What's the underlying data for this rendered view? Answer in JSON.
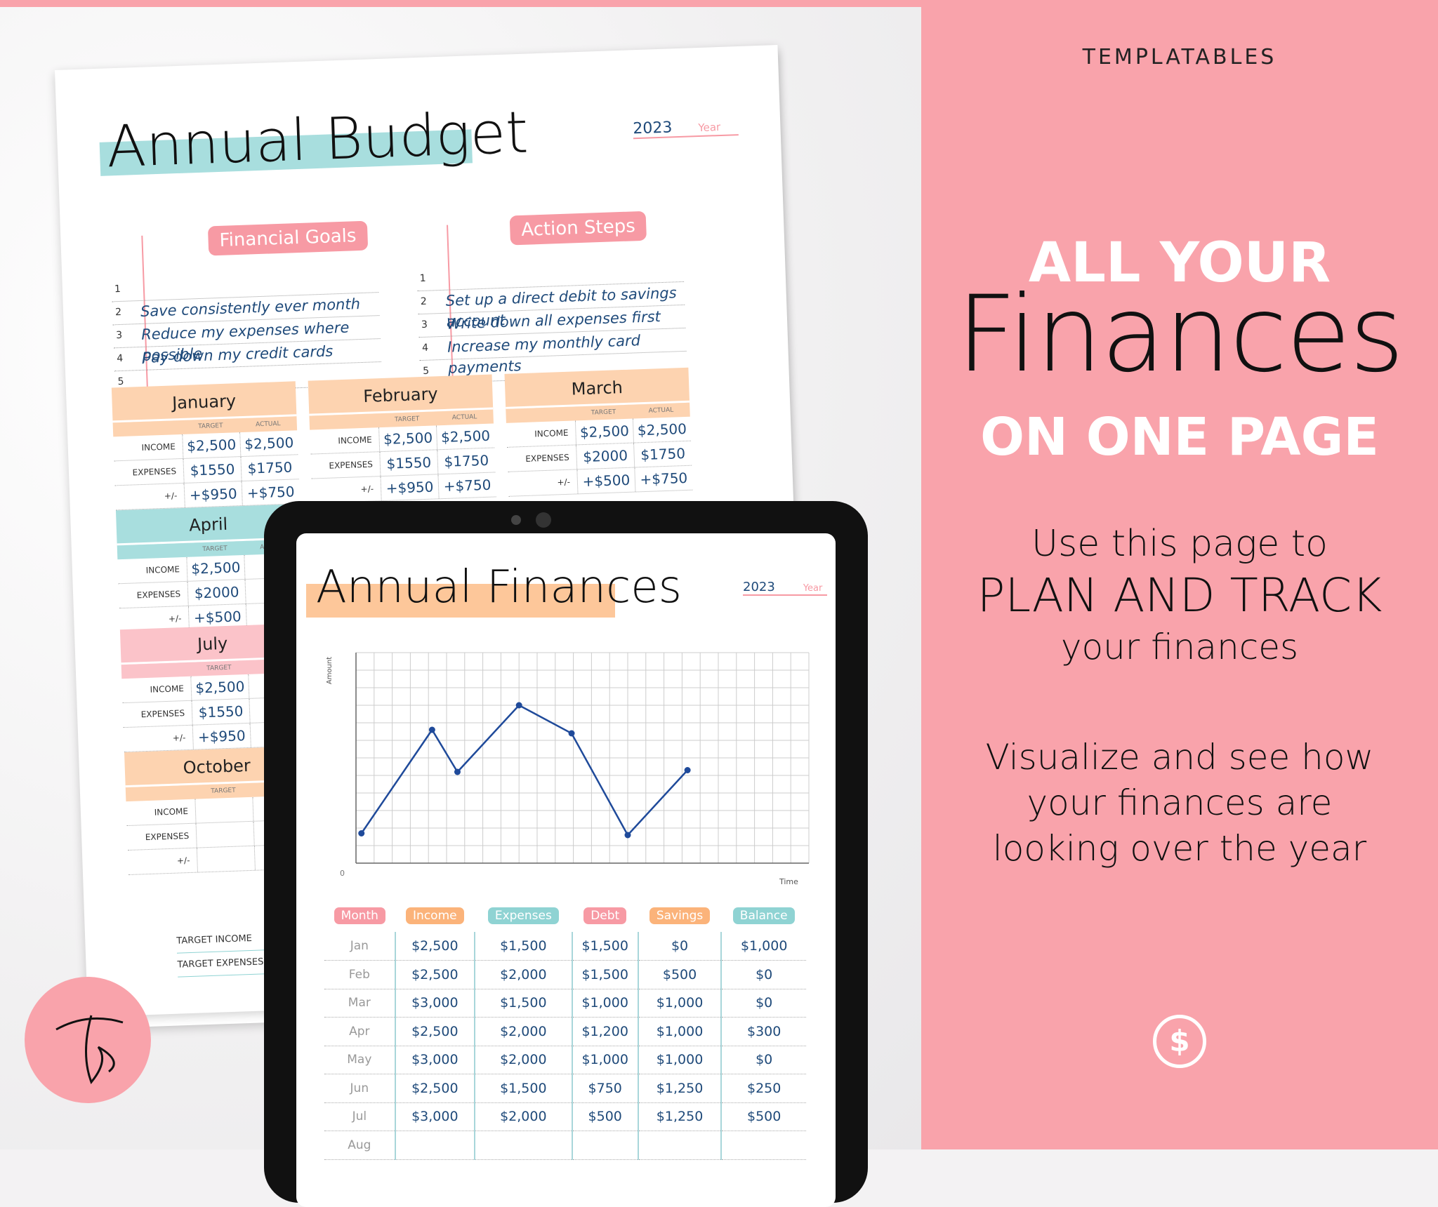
{
  "colors": {
    "pink": "#f9a3ab",
    "badge_pink": "#f79aa4",
    "teal": "#8fd3d3",
    "peach": "#fdd3b0",
    "orange": "#fbb37a",
    "navy": "#1f4a7a",
    "line": "#1f4a9a"
  },
  "budget": {
    "title": "Annual Budget",
    "year": "2023",
    "year_label": "Year",
    "goals_title": "Financial Goals",
    "steps_title": "Action Steps",
    "goals": [
      {
        "n": "1",
        "t": ""
      },
      {
        "n": "2",
        "t": "Save consistently ever month"
      },
      {
        "n": "3",
        "t": "Reduce my expenses where possible"
      },
      {
        "n": "4",
        "t": "Pay down my credit cards"
      },
      {
        "n": "5",
        "t": ""
      }
    ],
    "steps": [
      {
        "n": "1",
        "t": ""
      },
      {
        "n": "2",
        "t": "Set up a direct debit to savings account"
      },
      {
        "n": "3",
        "t": "Write down all expenses first"
      },
      {
        "n": "4",
        "t": "Increase my monthly card payments"
      },
      {
        "n": "5",
        "t": ""
      }
    ],
    "col_target": "TARGET",
    "col_actual": "ACTUAL",
    "row_labels": [
      "INCOME",
      "EXPENSES",
      "+/-"
    ],
    "months": [
      {
        "name": "January",
        "color": "#fdd3b0",
        "target": [
          "$2,500",
          "$1550",
          "+$950"
        ],
        "actual": [
          "$2,500",
          "$1750",
          "+$750"
        ]
      },
      {
        "name": "February",
        "color": "#fdd3b0",
        "target": [
          "$2,500",
          "$1550",
          "+$950"
        ],
        "actual": [
          "$2,500",
          "$1750",
          "+$750"
        ]
      },
      {
        "name": "March",
        "color": "#fdd3b0",
        "target": [
          "$2,500",
          "$2000",
          "+$500"
        ],
        "actual": [
          "$2,500",
          "$1750",
          "+$750"
        ]
      },
      {
        "name": "April",
        "color": "#a8dede",
        "target": [
          "$2,500",
          "$2000",
          "+$500"
        ],
        "actual": [
          "",
          "",
          ""
        ]
      },
      {
        "name": "July",
        "color": "#fbc3c9",
        "target": [
          "$2,500",
          "$1550",
          "+$950"
        ],
        "actual": [
          "",
          "",
          ""
        ]
      },
      {
        "name": "October",
        "color": "#fdd3b0",
        "target": [
          "",
          "",
          ""
        ],
        "actual": [
          "",
          "",
          ""
        ]
      }
    ],
    "footer": [
      "TARGET INCOME",
      "TARGET EXPENSES"
    ]
  },
  "tablet": {
    "title": "Annual Finances",
    "year": "2023",
    "year_label": "Year",
    "y_axis_label": "Amount",
    "x_axis_label": "Time",
    "zero_label": "0",
    "headers": [
      {
        "t": "Month",
        "c": "#f79aa4"
      },
      {
        "t": "Income",
        "c": "#fbb37a"
      },
      {
        "t": "Expenses",
        "c": "#8fd3d3"
      },
      {
        "t": "Debt",
        "c": "#f79aa4"
      },
      {
        "t": "Savings",
        "c": "#fbb37a"
      },
      {
        "t": "Balance",
        "c": "#8fd3d3"
      }
    ],
    "rows": [
      [
        "Jan",
        "$2,500",
        "$1,500",
        "$1,500",
        "$0",
        "$1,000"
      ],
      [
        "Feb",
        "$2,500",
        "$2,000",
        "$1,500",
        "$500",
        "$0"
      ],
      [
        "Mar",
        "$3,000",
        "$1,500",
        "$1,000",
        "$1,000",
        "$0"
      ],
      [
        "Apr",
        "$2,500",
        "$2,000",
        "$1,200",
        "$1,000",
        "$300"
      ],
      [
        "May",
        "$3,000",
        "$2,000",
        "$1,000",
        "$1,000",
        "$0"
      ],
      [
        "Jun",
        "$2,500",
        "$1,500",
        "$750",
        "$1,250",
        "$250"
      ],
      [
        "Jul",
        "$3,000",
        "$2,000",
        "$500",
        "$1,250",
        "$500"
      ],
      [
        "Aug",
        "",
        "",
        "",
        "",
        ""
      ]
    ]
  },
  "chart_data": {
    "type": "line",
    "xlabel": "Time",
    "ylabel": "Amount",
    "grid": true,
    "xlim": [
      0,
      25
    ],
    "ylim": [
      0,
      12
    ],
    "x": [
      0.3,
      4.2,
      5.6,
      9.0,
      11.9,
      15.0,
      18.3
    ],
    "y": [
      1.7,
      7.6,
      5.2,
      9.0,
      7.4,
      1.6,
      5.3
    ]
  },
  "panel": {
    "brand": "TEMPLATABLES",
    "line1": "ALL YOUR",
    "line2": "Finances",
    "line3": "ON ONE PAGE",
    "use1": "Use this page to",
    "use2": "PLAN AND TRACK",
    "use3": "your finances",
    "vis1": "Visualize and see how",
    "vis2": "your finances are",
    "vis3": "looking over the year",
    "icon": "dollar-icon"
  },
  "logo": "F"
}
